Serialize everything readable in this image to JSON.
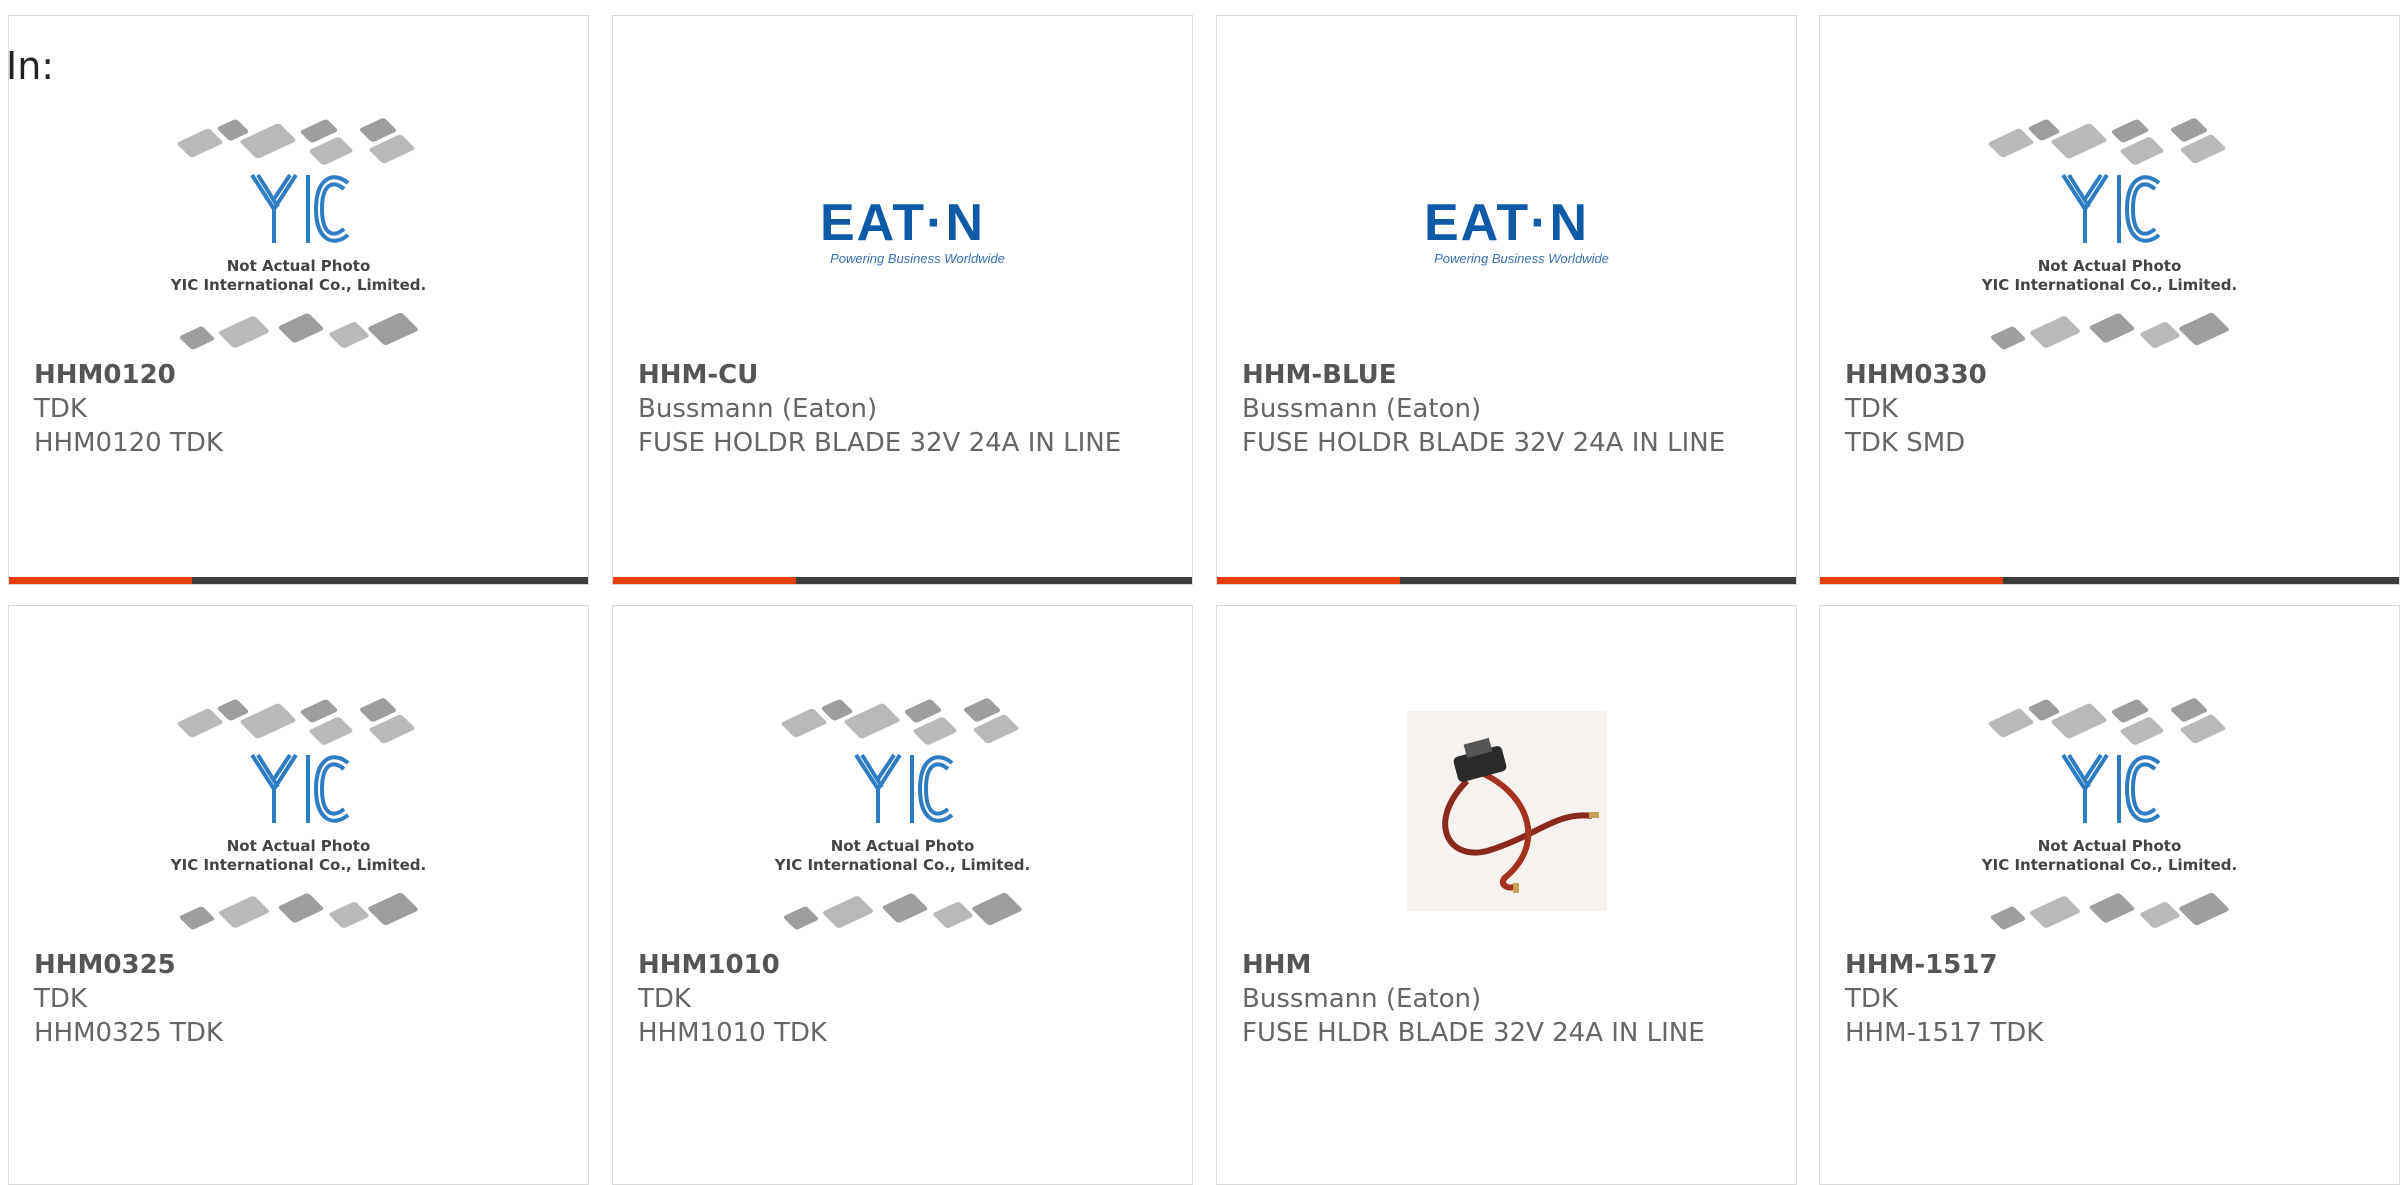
{
  "header": {
    "in_label": "In:"
  },
  "placeholder": {
    "line1": "Not Actual Photo",
    "line2": "YIC International Co., Limited.",
    "logo": "YIC"
  },
  "eaton": {
    "logo": "EAT·N",
    "tagline": "Powering Business Worldwide"
  },
  "colors": {
    "accent": "#e8400c",
    "bar": "#3d3d3d",
    "text": "#666666",
    "brand_blue": "#0f5aa6"
  },
  "products": [
    {
      "part": "HHM0120",
      "maker": "TDK",
      "desc": "HHM0120 TDK",
      "image": "yic-placeholder"
    },
    {
      "part": "HHM-CU",
      "maker": "Bussmann (Eaton)",
      "desc": "FUSE HOLDR BLADE 32V 24A IN LINE",
      "image": "eaton-logo"
    },
    {
      "part": "HHM-BLUE",
      "maker": "Bussmann (Eaton)",
      "desc": "FUSE HOLDR BLADE 32V 24A IN LINE",
      "image": "eaton-logo"
    },
    {
      "part": "HHM0330",
      "maker": "TDK",
      "desc": "TDK SMD",
      "image": "yic-placeholder"
    },
    {
      "part": "HHM0325",
      "maker": "TDK",
      "desc": "HHM0325 TDK",
      "image": "yic-placeholder"
    },
    {
      "part": "HHM1010",
      "maker": "TDK",
      "desc": "HHM1010 TDK",
      "image": "yic-placeholder"
    },
    {
      "part": "HHM",
      "maker": "Bussmann (Eaton)",
      "desc": "FUSE HLDR BLADE 32V 24A IN LINE",
      "image": "fuse-holder-photo"
    },
    {
      "part": "HHM-1517",
      "maker": "TDK",
      "desc": "HHM-1517 TDK",
      "image": "yic-placeholder"
    }
  ]
}
